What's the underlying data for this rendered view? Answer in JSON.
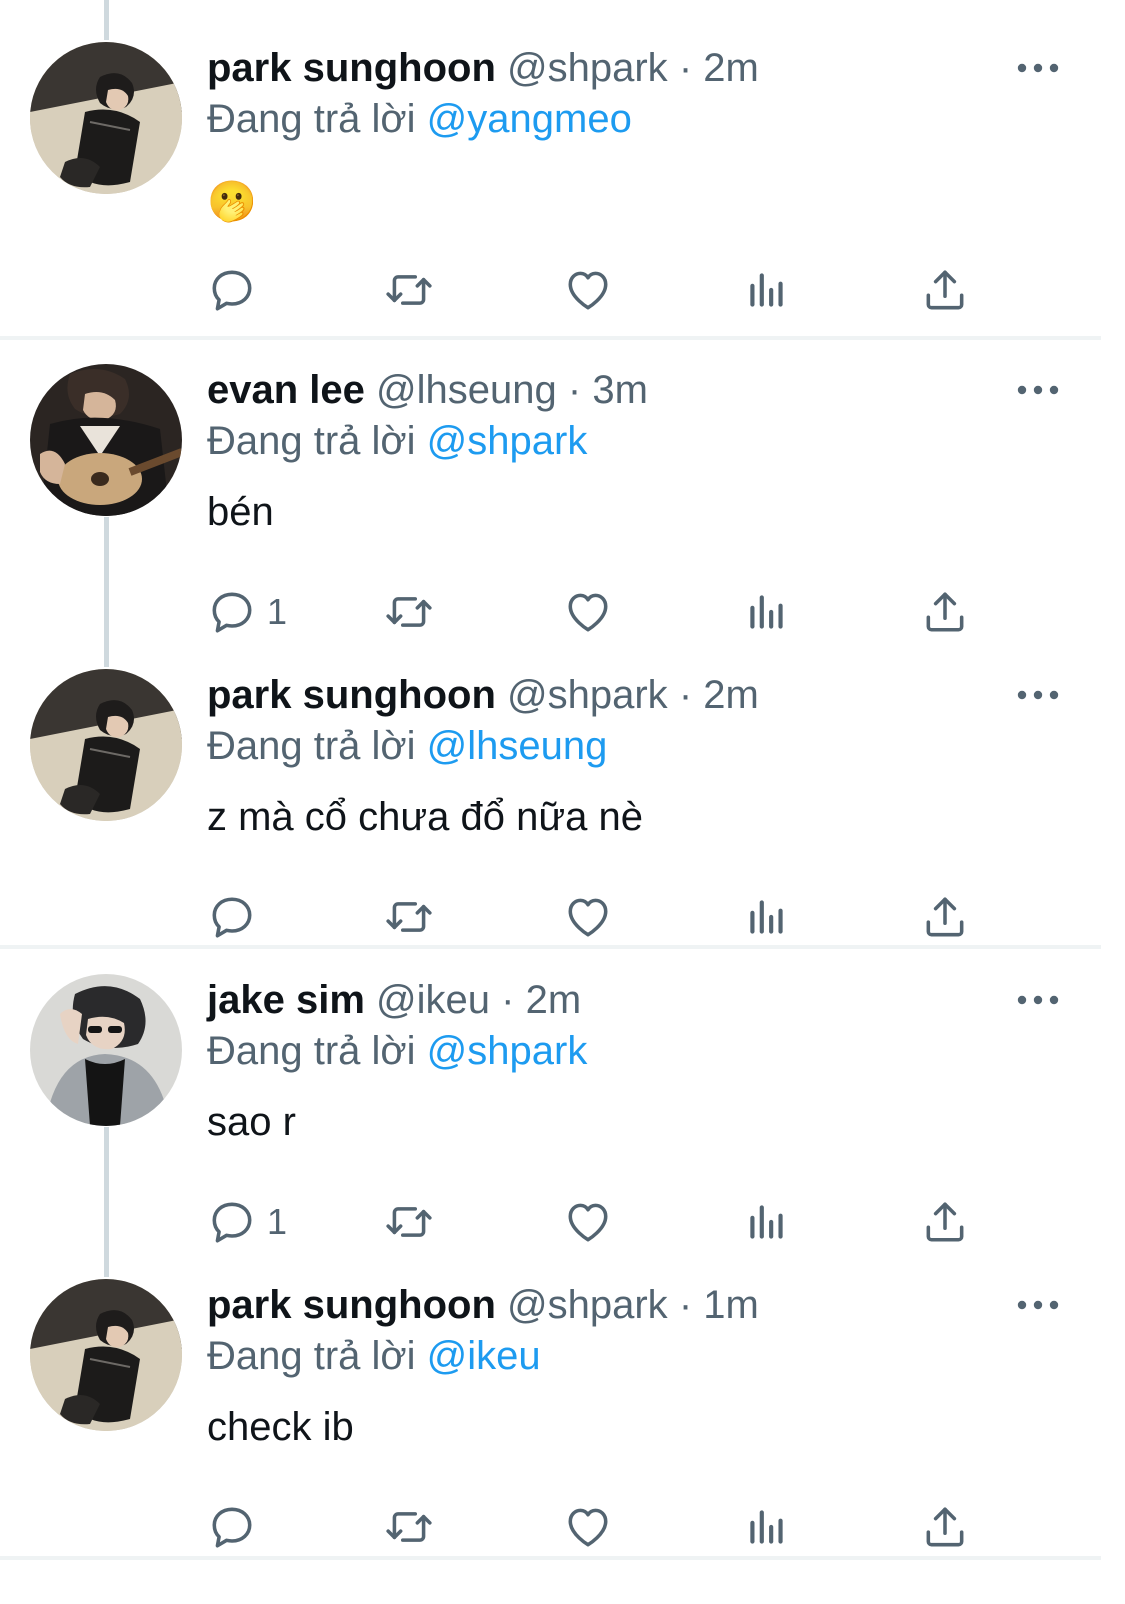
{
  "colors": {
    "accent": "#1d9bf0",
    "secondary_text": "#536471",
    "primary_text": "#0f1419",
    "thread_line": "#cfd9de"
  },
  "replying_prefix": "Đang trả lời",
  "tweets": [
    {
      "name": "park sunghoon",
      "handle": "@shpark",
      "time": "2m",
      "replying_to": "@yangmeo",
      "text": "🫢",
      "reply_count": "",
      "avatar_icon": "person-on-couch-avatar"
    },
    {
      "name": "evan lee",
      "handle": "@lhseung",
      "time": "3m",
      "replying_to": "@shpark",
      "text": "bén",
      "reply_count": "1",
      "avatar_icon": "person-with-guitar-avatar"
    },
    {
      "name": "park sunghoon",
      "handle": "@shpark",
      "time": "2m",
      "replying_to": "@lhseung",
      "text": "z mà cổ chưa đổ nữa nè",
      "reply_count": "",
      "avatar_icon": "person-on-couch-avatar"
    },
    {
      "name": "jake sim",
      "handle": "@ikeu",
      "time": "2m",
      "replying_to": "@shpark",
      "text": "sao r",
      "reply_count": "1",
      "avatar_icon": "person-with-sunglasses-avatar"
    },
    {
      "name": "park sunghoon",
      "handle": "@shpark",
      "time": "1m",
      "replying_to": "@ikeu",
      "text": "check ib",
      "reply_count": "",
      "avatar_icon": "person-on-couch-avatar"
    }
  ],
  "dot_separator": "·",
  "icons": [
    "reply-icon",
    "retweet-icon",
    "like-icon",
    "views-icon",
    "share-icon",
    "more-options-icon"
  ]
}
